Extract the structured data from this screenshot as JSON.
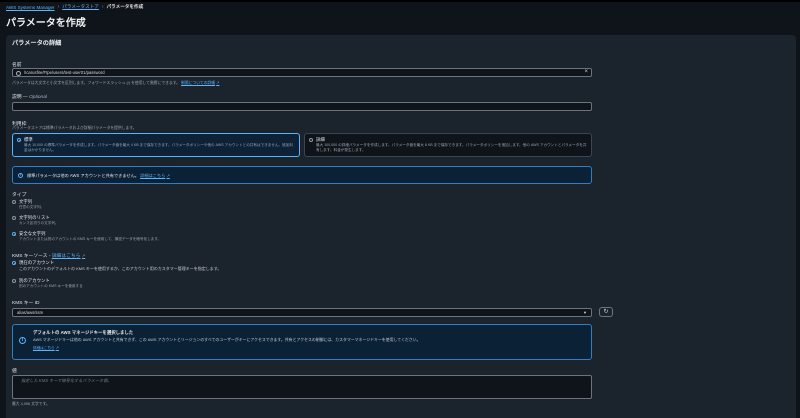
{
  "breadcrumb": {
    "items": [
      "AWS Systems Manager",
      "パラメータストア"
    ],
    "current": "パラメータを作成"
  },
  "page_title": "パラメータを作成",
  "panel_title": "パラメータの詳細",
  "name": {
    "label": "名前",
    "value": "/Icarusfire/Ftpe/users/test-user01/password",
    "help": "パラメータは大文字と小文字を区別します。フォワードスラッシュ (/) を使用して階層にできます。",
    "help_link": "制限についての詳細"
  },
  "description": {
    "label": "説明 — ",
    "optional": "Optional",
    "value": ""
  },
  "tier": {
    "label": "利用枠",
    "help": "パラメータストアは標準パラメータおよび詳細パラメータを提供します。",
    "options": [
      {
        "title": "標準",
        "desc": "最大 10,000 の標準パラメータを作成します。パラメータ値を最大 4 KB まで保存できます。パラメータポリシーや他の AWS アカウントとの共有はできません。追加料金はかかりません。",
        "selected": true
      },
      {
        "title": "詳細",
        "desc": "最大 100,000 の詳細パラメータを作成します。パラメータ値を最大 8 KB まで保存できます。パラメータポリシーを追加します。他の AWS アカウントとパラメータを共有します。料金が発生します。",
        "selected": false
      }
    ]
  },
  "share_alert": {
    "text": "標準パラメータは他の AWS アカウントと共有できません。",
    "link": "詳細はこちら"
  },
  "type": {
    "label": "タイプ",
    "options": [
      {
        "title": "文字列",
        "desc": "任意の文字列。",
        "selected": false
      },
      {
        "title": "文字列のリスト",
        "desc": "カンマ区切りの文字列。",
        "selected": false
      },
      {
        "title": "安全な文字列",
        "desc": "アカウントまたは別のアカウントの KMS キーを使用して、機密データを暗号化します。",
        "selected": true
      }
    ]
  },
  "kms_source": {
    "label": "KMS キーソース",
    "link": "詳細はこちら",
    "options": [
      {
        "title": "現在のアカウント",
        "desc": "このアカウントのデフォルトの KMS キーを使用するか、このアカウント用のカスタマー管理キーを指定します。",
        "selected": true
      },
      {
        "title": "別のアカウント",
        "desc": "別のアカウントの KMS キーを使用する",
        "selected": false
      }
    ]
  },
  "kms_key_id": {
    "label": "KMS キー ID",
    "value": "alias/aws/ssm"
  },
  "managed_key_alert": {
    "title": "デフォルトの AWS マネージドキーを選択しました",
    "text": "AWS マネージドキーは他の AWS アカウントと共有できず、この AWS アカウントとリージョンのすべてのユーザーがキーにアクセスできます。共有とアクセスの制御には、カスタマーマネージドキーを使用してください。",
    "link": "詳細はこちら"
  },
  "value": {
    "label": "値",
    "placeholder": "指定した KMS キーで暗号化するパラメータ値。",
    "help": "最大 4,096 文字です。"
  },
  "icons": [
    "search-icon",
    "clear-icon",
    "info-icon",
    "external-link-icon",
    "chevron-down-icon",
    "refresh-icon"
  ],
  "colors": {
    "accent": "#5db3f7",
    "background": "#0f141a",
    "panel": "#1b232d"
  }
}
